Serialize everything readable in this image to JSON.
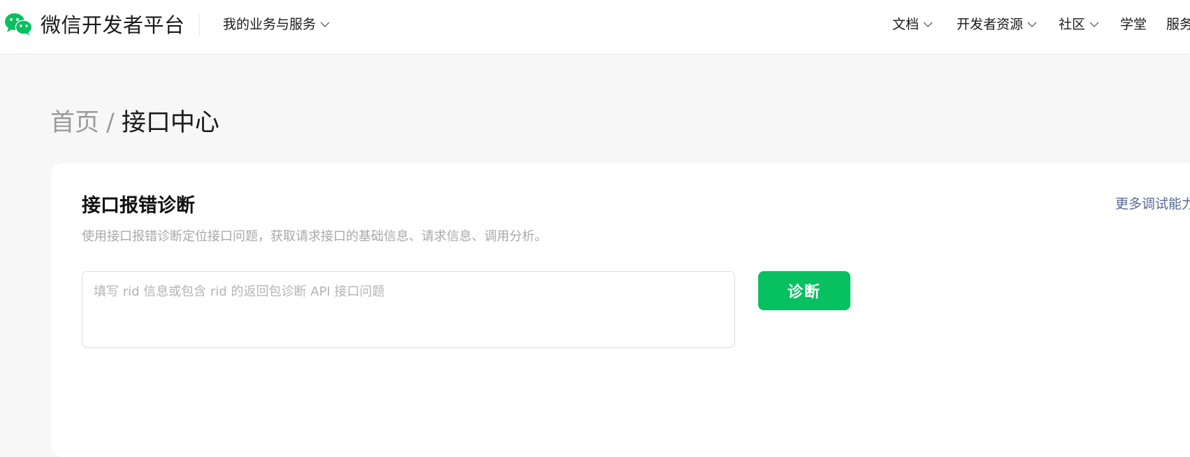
{
  "header": {
    "brand": "微信开发者平台",
    "biz_menu": "我的业务与服务",
    "nav": {
      "docs": "文档",
      "resources": "开发者资源",
      "community": "社区",
      "academy": "学堂",
      "service": "服务"
    }
  },
  "breadcrumb": {
    "home": "首页",
    "separator": "/",
    "current": "接口中心"
  },
  "card": {
    "title": "接口报错诊断",
    "description": "使用接口报错诊断定位接口问题，获取请求接口的基础信息、请求信息、调用分析。",
    "more_link": "更多调试能力",
    "input": {
      "value": "",
      "placeholder": "填写 rid 信息或包含 rid 的返回包诊断 API 接口问题"
    },
    "button": "诊断"
  },
  "colors": {
    "brand_green": "#07c160",
    "link_blue": "#576b95",
    "page_bg": "#f7f7f7"
  },
  "icons": {
    "logo": "wechat-logo-icon",
    "dropdown": "chevron-down-icon"
  }
}
